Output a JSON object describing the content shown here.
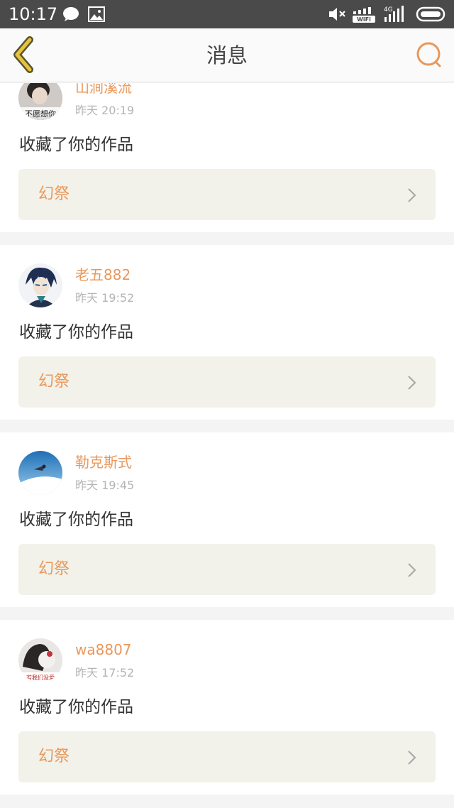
{
  "statusbar": {
    "time": "10:17",
    "icons": [
      "chat-bubble-icon",
      "image-icon",
      "mute-icon",
      "wifi-icon",
      "4g-signal-icon",
      "battery-icon"
    ],
    "network_label": "4G",
    "wifi_label": "WiFi"
  },
  "header": {
    "title": "消息",
    "back_icon": "chevron-left-icon",
    "search_icon": "search-icon",
    "accent_color": "#e8985c",
    "back_color": "#e5c43a"
  },
  "messages": [
    {
      "username": "山涧溪流",
      "time": "昨天 20:19",
      "action": "收藏了你的作品",
      "work_title": "幻祭",
      "avatar_caption": "不愿想你"
    },
    {
      "username": "老五882",
      "time": "昨天 19:52",
      "action": "收藏了你的作品",
      "work_title": "幻祭"
    },
    {
      "username": "勒克斯式",
      "time": "昨天 19:45",
      "action": "收藏了你的作品",
      "work_title": "幻祭"
    },
    {
      "username": "wa8807",
      "time": "昨天 17:52",
      "action": "收藏了你的作品",
      "work_title": "幻祭",
      "avatar_caption": "若我们没爱"
    }
  ]
}
